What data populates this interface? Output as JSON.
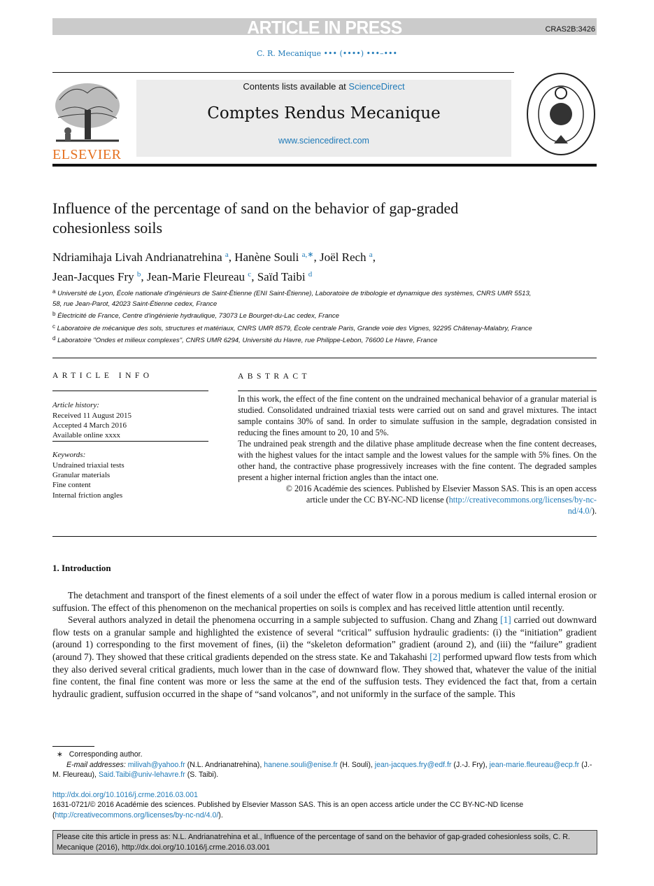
{
  "header": {
    "banner": "ARTICLE IN PRESS",
    "code": "CRAS2B:3426",
    "journal_ref": "C. R. Mecanique ••• (••••) •••–•••",
    "contents_prefix": "Contents lists available at ",
    "contents_link": "ScienceDirect",
    "journal": "Comptes Rendus Mecanique",
    "url": "www.sciencedirect.com",
    "publisher_logo": "ELSEVIER"
  },
  "article": {
    "title": "Influence of the percentage of sand on the behavior of gap-graded cohesionless soils",
    "authors": [
      {
        "name": "Ndriamihaja Livah Andrianatrehina",
        "sup": "a"
      },
      {
        "name": "Hanène Souli",
        "sup": "a,∗"
      },
      {
        "name": "Joël Rech",
        "sup": "a"
      },
      {
        "name": "Jean-Jacques Fry",
        "sup": "b"
      },
      {
        "name": "Jean-Marie Fleureau",
        "sup": "c"
      },
      {
        "name": "Saïd Taibi",
        "sup": "d"
      }
    ],
    "affiliations": [
      {
        "sup": "a",
        "text": "Université de Lyon, École nationale d'ingénieurs de Saint-Étienne (ENI Saint-Étienne), Laboratoire de tribologie et dynamique des systèmes, CNRS UMR 5513, 58, rue Jean-Parot, 42023 Saint-Étienne cedex, France"
      },
      {
        "sup": "b",
        "text": "Électricité de France, Centre d'ingénierie hydraulique, 73073 Le Bourget-du-Lac cedex, France"
      },
      {
        "sup": "c",
        "text": "Laboratoire de mécanique des sols, structures et matériaux, CNRS UMR 8579, École centrale Paris, Grande voie des Vignes, 92295 Châtenay-Malabry, France"
      },
      {
        "sup": "d",
        "text": "Laboratoire \"Ondes et milieux complexes\", CNRS UMR 6294, Université du Havre, rue Philippe-Lebon, 76600 Le Havre, France"
      }
    ]
  },
  "info": {
    "heading": "ARTICLE INFO",
    "history_label": "Article history:",
    "history": [
      "Received 11 August 2015",
      "Accepted 4 March 2016",
      "Available online xxxx"
    ],
    "keywords_label": "Keywords:",
    "keywords": [
      "Undrained triaxial tests",
      "Granular materials",
      "Fine content",
      "Internal friction angles"
    ]
  },
  "abstract": {
    "heading": "ABSTRACT",
    "p1": "In this work, the effect of the fine content on the undrained mechanical behavior of a granular material is studied. Consolidated undrained triaxial tests were carried out on sand and gravel mixtures. The intact sample contains 30% of sand. In order to simulate suffusion in the sample, degradation consisted in reducing the fines amount to 20, 10 and 5%.",
    "p2": "The undrained peak strength and the dilative phase amplitude decrease when the fine content decreases, with the highest values for the intact sample and the lowest values for the sample with 5% fines. On the other hand, the contractive phase progressively increases with the fine content. The degraded samples present a higher internal friction angles than the intact one.",
    "copyright": "© 2016 Académie des sciences. Published by Elsevier Masson SAS. This is an open access article under the CC BY-NC-ND license",
    "license_link": "http://creativecommons.org/licenses/by-nc-nd/4.0/"
  },
  "intro": {
    "heading": "1.  Introduction",
    "p1": "The detachment and transport of the finest elements of a soil under the effect of water flow in a porous medium is called internal erosion or suffusion. The effect of this phenomenon on the mechanical properties on soils is complex and has received little attention until recently.",
    "p2a": "Several authors analyzed in detail the phenomena occurring in a sample subjected to suffusion. Chang and Zhang ",
    "ref1": "[1]",
    "p2b": " carried out downward flow tests on a granular sample and highlighted the existence of several “critical” suffusion hydraulic gradients: (i) the “initiation” gradient (around 1) corresponding to the first movement of fines, (ii) the “skeleton deformation” gradient (around 2), and (iii) the “failure” gradient (around 7). They showed that these critical gradients depended on the stress state. Ke and Takahashi ",
    "ref2": "[2]",
    "p2c": " performed upward flow tests from which they also derived several critical gradients, much lower than in the case of downward flow. They showed that, whatever the value of the initial fine content, the final fine content was more or less the same at the end of the suffusion tests. They evidenced the fact that, from a certain hydraulic gradient, suffusion occurred in the shape of “sand volcanos”, and not uniformly in the surface of the sample. This"
  },
  "footnotes": {
    "star": "∗",
    "corresponding": "Corresponding author.",
    "email_label": "E-mail addresses:",
    "emails": [
      {
        "addr": "milivah@yahoo.fr",
        "who": " (N.L. Andrianatrehina), "
      },
      {
        "addr": "hanene.souli@enise.fr",
        "who": " (H. Souli), "
      },
      {
        "addr": "jean-jacques.fry@edf.fr",
        "who": " (J.-J. Fry), "
      },
      {
        "addr": "jean-marie.fleureau@ecp.fr",
        "who": " (J.-M. Fleureau), "
      },
      {
        "addr": "Said.Taibi@univ-lehavre.fr",
        "who": " (S. Taibi)."
      }
    ],
    "doi": "http://dx.doi.org/10.1016/j.crme.2016.03.001",
    "issn_line": "1631-0721/© 2016 Académie des sciences. Published by Elsevier Masson SAS. This is an open access article under the CC BY-NC-ND license",
    "license_link": "http://creativecommons.org/licenses/by-nc-nd/4.0/"
  },
  "cite": "Please cite this article in press as: N.L. Andrianatrehina et al., Influence of the percentage of sand on the behavior of gap-graded cohesionless soils, C. R. Mecanique (2016), http://dx.doi.org/10.1016/j.crme.2016.03.001",
  "colors": {
    "link": "#1f7ab8",
    "banner": "#cbcbcb",
    "elsevier": "#e5701f"
  }
}
